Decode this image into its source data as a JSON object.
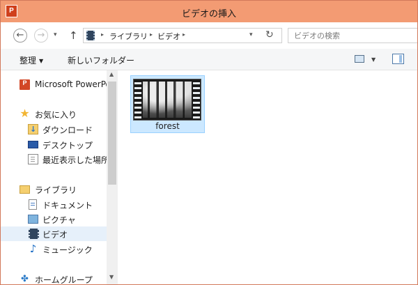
{
  "window": {
    "title": "ビデオの挿入",
    "app_icon_text": "P"
  },
  "nav": {
    "back_glyph": "←",
    "forward_glyph": "→",
    "recent_glyph": "▾",
    "up_glyph": "↑"
  },
  "address": {
    "crumbs": [
      "ライブラリ",
      "ビデオ"
    ],
    "separator": "▸",
    "refresh_glyph": "↻"
  },
  "search": {
    "placeholder": "ビデオの検索"
  },
  "toolbar": {
    "organize_label": "整理",
    "organize_caret": "▼",
    "new_folder_label": "新しいフォルダー",
    "view_caret": "▼"
  },
  "sidebar": {
    "items": [
      {
        "label": "Microsoft PowerPoint",
        "icon": "powerpoint-icon",
        "icon_text": "P"
      },
      {
        "label": "お気に入り",
        "icon": "star-icon",
        "icon_text": "★"
      },
      {
        "label": "ダウンロード",
        "icon": "downloads-folder-icon"
      },
      {
        "label": "デスクトップ",
        "icon": "desktop-icon"
      },
      {
        "label": "最近表示した場所",
        "icon": "recent-places-icon"
      },
      {
        "label": "ライブラリ",
        "icon": "libraries-icon"
      },
      {
        "label": "ドキュメント",
        "icon": "documents-icon"
      },
      {
        "label": "ピクチャ",
        "icon": "pictures-icon"
      },
      {
        "label": "ビデオ",
        "icon": "videos-icon",
        "selected": true
      },
      {
        "label": "ミュージック",
        "icon": "music-icon",
        "icon_text": "♪"
      },
      {
        "label": "ホームグループ",
        "icon": "homegroup-icon",
        "icon_text": "✤"
      }
    ]
  },
  "scrollbar": {
    "up_glyph": "▲",
    "down_glyph": "▼"
  },
  "content": {
    "files": [
      {
        "name": "forest",
        "type": "video",
        "selected": true
      }
    ]
  },
  "colors": {
    "title_bar": "#f39b73",
    "selection": "#cce8ff",
    "nav_selected": "#e6f0fa"
  }
}
